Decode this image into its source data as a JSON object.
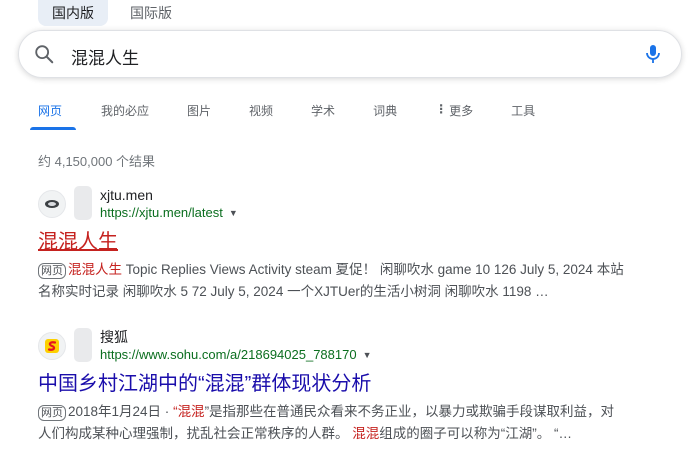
{
  "region_tabs": [
    {
      "label": "国内版",
      "active": true
    },
    {
      "label": "国际版",
      "active": false
    }
  ],
  "search": {
    "query": "混混人生"
  },
  "nav": {
    "items": [
      "网页",
      "我的必应",
      "图片",
      "视频",
      "学术",
      "词典",
      "更多",
      "工具"
    ],
    "active": "网页"
  },
  "result_count": "约 4,150,000 个结果",
  "results": [
    {
      "site_name": "xjtu.men",
      "url": "https://xjtu.men/latest",
      "title": "混混人生",
      "badge": "网页",
      "snippet_line1_hl": "混混人生",
      "snippet_line1_rest": " Topic Replies Views Activity steam 夏促！ 闲聊吹水 game 10 126 July 5, 2024 本站",
      "snippet_line2": "名称实时记录 闲聊吹水 5 72 July 5, 2024 一个XJTUer的生活小树洞 闲聊吹水 1198 …"
    },
    {
      "site_name": "搜狐",
      "url": "https://www.sohu.com/a/218694025_788170",
      "title": "中国乡村江湖中的“混混”群体现状分析",
      "badge": "网页",
      "date": "2018年1月24日 · ",
      "snippet_q1": "“",
      "snippet_hl1": "混混",
      "snippet_line1_rest": "”是指那些在普通民众看来不务正业，以暴力或欺骗手段谋取利益，对",
      "snippet_line2_a": "人们构成某种心理强制，扰乱社会正常秩序的人群。 ",
      "snippet_hl2": "混混",
      "snippet_line2_b": "组成的圈子可以称为“江湖”。 “…"
    }
  ],
  "colors": {
    "accent": "#1a73e8",
    "title_link": "#1a0dab",
    "visited_highlight": "#c5221f",
    "url_green": "#0b6e1f"
  }
}
